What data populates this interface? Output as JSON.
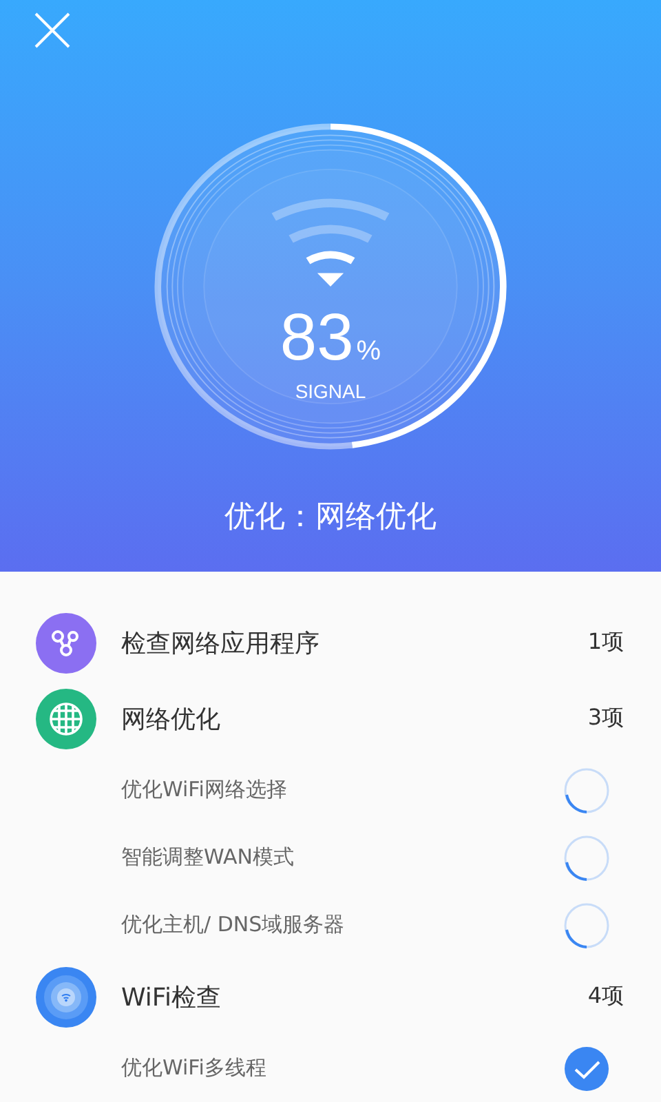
{
  "header": {
    "gauge": {
      "value": "83",
      "unit": "%",
      "label": "SIGNAL"
    },
    "title": "优化：网络优化"
  },
  "groups": [
    {
      "title": "检查网络应用程序",
      "count": "1项"
    },
    {
      "title": "网络优化",
      "count": "3项",
      "items": [
        {
          "label": "优化WiFi网络选择",
          "checked": false
        },
        {
          "label": "智能调整WAN模式",
          "checked": false
        },
        {
          "label": "优化主机/ DNS域服务器",
          "checked": false
        }
      ]
    },
    {
      "title": "WiFi检查",
      "count": "4项",
      "items": [
        {
          "label": "优化WiFi多线程",
          "checked": true
        }
      ]
    }
  ]
}
